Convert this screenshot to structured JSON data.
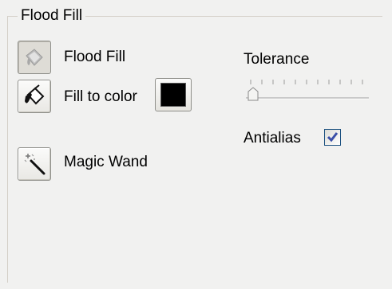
{
  "group": {
    "title": "Flood Fill"
  },
  "tools": {
    "flood_fill": {
      "label": "Flood Fill",
      "icon": "flood-fill-icon",
      "pressed": true
    },
    "fill_to_color": {
      "label": "Fill to color",
      "icon": "paint-bucket-icon",
      "swatch_color": "#000000"
    },
    "magic_wand": {
      "label": "Magic Wand",
      "icon": "magic-wand-icon"
    }
  },
  "tolerance": {
    "label": "Tolerance",
    "value_fraction": 0.05
  },
  "antialias": {
    "label": "Antialias",
    "checked": true
  },
  "colors": {
    "panel_background": "#f1f1f0",
    "checkmark": "#3a4fa8",
    "checkbox_border": "#1c5180"
  }
}
